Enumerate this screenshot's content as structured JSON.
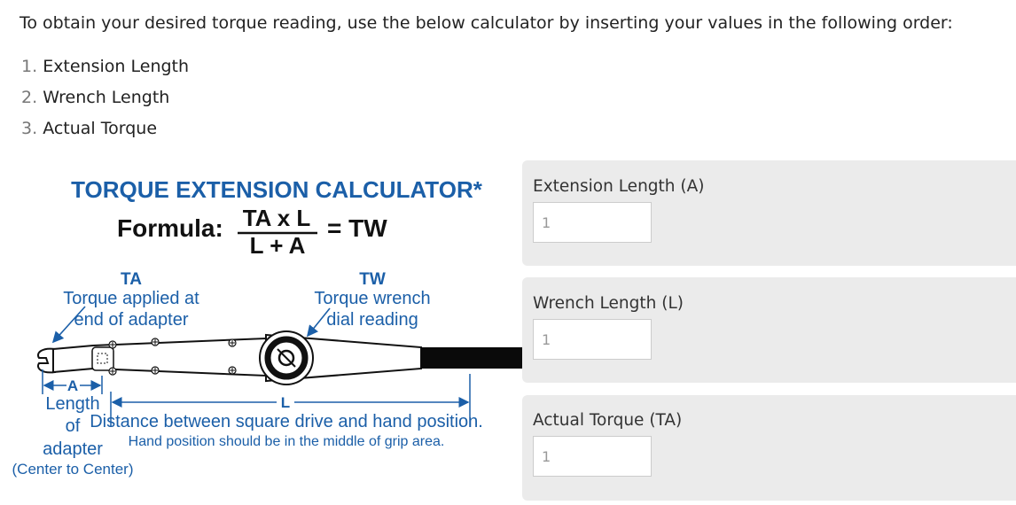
{
  "intro": "To obtain your desired torque reading, use the below calculator by inserting your values in the following order:",
  "steps": [
    {
      "num": "1.",
      "label": "Extension Length"
    },
    {
      "num": "2.",
      "label": "Wrench Length"
    },
    {
      "num": "3.",
      "label": "Actual Torque"
    }
  ],
  "diagram": {
    "title": "TORQUE EXTENSION CALCULATOR*",
    "formula_label": "Formula:",
    "numerator": "TA x L",
    "denominator": "L + A",
    "result": "= TW",
    "ta_abbr": "TA",
    "ta_line1": "Torque applied at",
    "ta_line2": "end of adapter",
    "tw_abbr": "TW",
    "tw_line1": "Torque wrench",
    "tw_line2": "dial reading",
    "a_marker": "A",
    "l_marker": "L",
    "length_line1": "Length",
    "length_line2": "of",
    "length_line3": "adapter",
    "length_line4": "(Center to Center)",
    "distance_line1": "Distance between square drive and hand position.",
    "distance_line2": "Hand position should be in the middle of grip area."
  },
  "form": {
    "extension_label": "Extension Length (A)",
    "extension_value": "1",
    "wrench_label": "Wrench Length (L)",
    "wrench_value": "1",
    "torque_label": "Actual Torque (TA)",
    "torque_value": "1"
  },
  "colors": {
    "diagram_blue": "#1b5fa8",
    "panel_bg": "#ebebeb"
  }
}
